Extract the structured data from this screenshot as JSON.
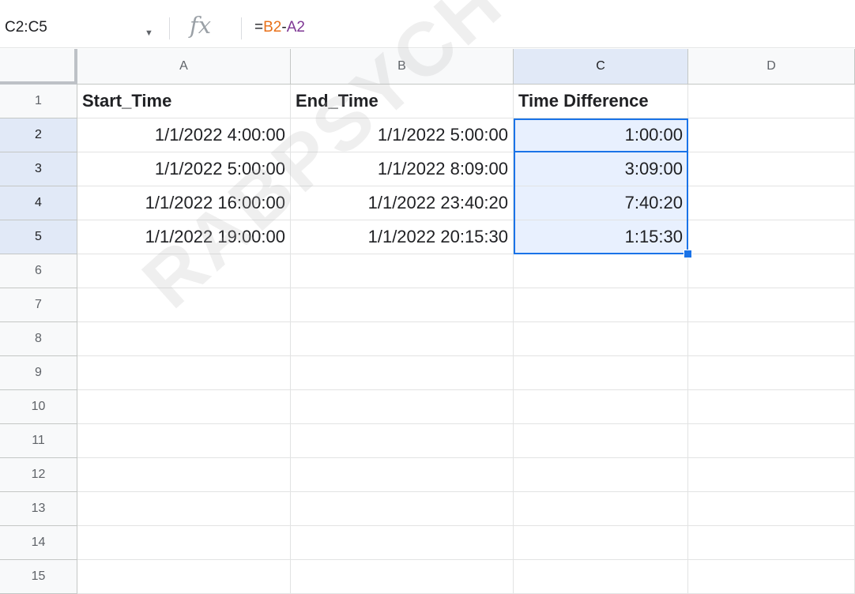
{
  "name_box": "C2:C5",
  "formula": {
    "eq": "=",
    "ref1": "B2",
    "op": "-",
    "ref2": "A2"
  },
  "columns": [
    "A",
    "B",
    "C",
    "D"
  ],
  "rows": [
    "1",
    "2",
    "3",
    "4",
    "5",
    "6",
    "7",
    "8",
    "9",
    "10",
    "11",
    "12",
    "13",
    "14",
    "15"
  ],
  "cells": {
    "A1": "Start_Time",
    "B1": "End_Time",
    "C1": "Time Difference",
    "A2": "1/1/2022 4:00:00",
    "B2": "1/1/2022 5:00:00",
    "C2": "1:00:00",
    "A3": "1/1/2022 5:00:00",
    "B3": "1/1/2022 8:09:00",
    "C3": "3:09:00",
    "A4": "1/1/2022 16:00:00",
    "B4": "1/1/2022 23:40:20",
    "C4": "7:40:20",
    "A5": "1/1/2022 19:00:00",
    "B5": "1/1/2022 20:15:30",
    "C5": "1:15:30"
  },
  "watermark": "RABPSYCHOLOGY.",
  "colors": {
    "selection": "#1a73e8",
    "selection_fill": "#e8f0fe"
  },
  "icons": {
    "name_box_dropdown": "caret-down-icon",
    "function": "fx-icon"
  }
}
